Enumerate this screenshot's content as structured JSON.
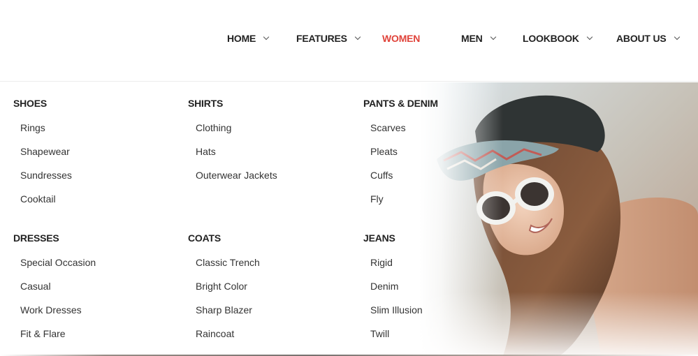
{
  "nav": {
    "items": [
      {
        "label": "HOME",
        "has_dropdown": true,
        "active": false
      },
      {
        "label": "FEATURES",
        "has_dropdown": true,
        "active": false
      },
      {
        "label": "WOMEN",
        "has_dropdown": false,
        "active": true
      },
      {
        "label": "MEN",
        "has_dropdown": true,
        "active": false
      },
      {
        "label": "LOOKBOOK",
        "has_dropdown": true,
        "active": false
      },
      {
        "label": "ABOUT US",
        "has_dropdown": true,
        "active": false
      }
    ],
    "active_color": "#e0433a"
  },
  "mega_menu": {
    "groups": [
      {
        "heading": "SHOES",
        "links": [
          "Rings",
          "Shapewear",
          "Sundresses",
          "Cooktail"
        ]
      },
      {
        "heading": "SHIRTS",
        "links": [
          "Clothing",
          "Hats",
          "Outerwear Jackets"
        ]
      },
      {
        "heading": "PANTS & DENIM",
        "links": [
          "Scarves",
          "Pleats",
          "Cuffs",
          "Fly"
        ]
      },
      {
        "heading": "DRESSES",
        "links": [
          "Special Occasion",
          "Casual",
          "Work Dresses",
          "Fit & Flare"
        ]
      },
      {
        "heading": "COATS",
        "links": [
          "Classic Trench",
          "Bright Color",
          "Sharp Blazer",
          "Raincoat"
        ]
      },
      {
        "heading": "JEANS",
        "links": [
          "Rigid",
          "Denim",
          "Slim Illusion",
          "Twill"
        ]
      }
    ]
  },
  "promo": {
    "icon": "woman-in-cap-and-sunglasses-photo"
  }
}
